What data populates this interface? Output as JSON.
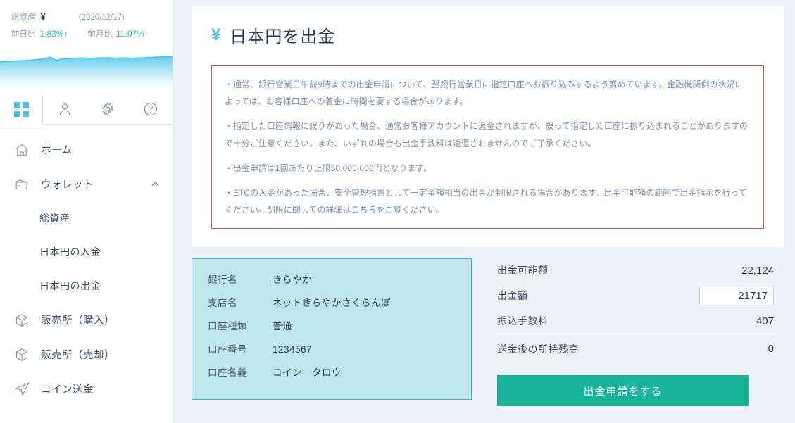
{
  "sidebar": {
    "asset": {
      "label": "総資産",
      "currency": "¥",
      "date": "(2020/12/17)",
      "day_label": "前日比",
      "day_value": "1.83%↑",
      "month_label": "前月比",
      "month_value": "11.07%↑",
      "accent_color": "#1fc2a7",
      "spark_color": "#3fc3e8"
    },
    "tabs": [
      {
        "icon": "grid-icon",
        "active": true
      },
      {
        "icon": "person-icon",
        "active": false
      },
      {
        "icon": "gear-icon",
        "active": false
      },
      {
        "icon": "question-icon",
        "active": false
      }
    ],
    "nav": [
      {
        "label": "ホーム",
        "icon": "home-icon"
      },
      {
        "label": "ウォレット",
        "icon": "wallet-icon",
        "chevron": "chevron-up-icon"
      },
      {
        "label": "総資産",
        "sub": true
      },
      {
        "label": "日本円の入金",
        "sub": true
      },
      {
        "label": "日本円の出金",
        "sub": true
      },
      {
        "label": "販売所（購入）",
        "icon": "box-icon"
      },
      {
        "label": "販売所（売却）",
        "icon": "box-icon"
      },
      {
        "label": "コイン送金",
        "icon": "send-icon"
      }
    ]
  },
  "main": {
    "title": "日本円を出金",
    "title_currency": "¥",
    "notice": {
      "border_color": "#d0564a",
      "paragraphs": [
        "・通常、銀行営業日午前9時までの出金申請について、翌銀行営業日に指定口座へお振り込みするよう努めています。金融機関側の状況によっては、お客様口座への着金に時間を要する場合があります。",
        "・指定した口座情報に誤りがあった場合、通常お客様アカウントに返金されますが、誤って指定した口座に振り込まれることがありますので十分ご注意ください。また、いずれの場合も出金手数料は返還されませんのでご了承ください。",
        "・出金申請は1回あたり上限50,000,000円となります。"
      ],
      "last_paragraph_pre": "・ETCの入金があった場合、安全管理措置として一定金額相当の出金が制限される場合があります。出金可能額の範囲で出金指示を行ってください。制限に関しての詳細は",
      "last_paragraph_link": "こちら",
      "last_paragraph_post": "をご覧ください。"
    },
    "bank_card": {
      "rows": [
        {
          "key": "銀行名",
          "value": "きらやか"
        },
        {
          "key": "支店名",
          "value": "ネットきらやかさくらんぼ"
        },
        {
          "key": "口座種類",
          "value": "普通"
        },
        {
          "key": "口座番号",
          "value": "1234567"
        },
        {
          "key": "口座名義",
          "value": "コイン　タロウ"
        }
      ]
    },
    "amount": {
      "available_label": "出金可能額",
      "available_value": "22,124",
      "withdraw_label": "出金額",
      "withdraw_value": "21717",
      "withdraw_placeholder": "",
      "fee_label": "振込手数料",
      "fee_value": "407",
      "balance_label": "送金後の所持残高",
      "balance_value": "0",
      "submit_label": "出金申請をする",
      "submit_color": "#18b49a"
    }
  }
}
